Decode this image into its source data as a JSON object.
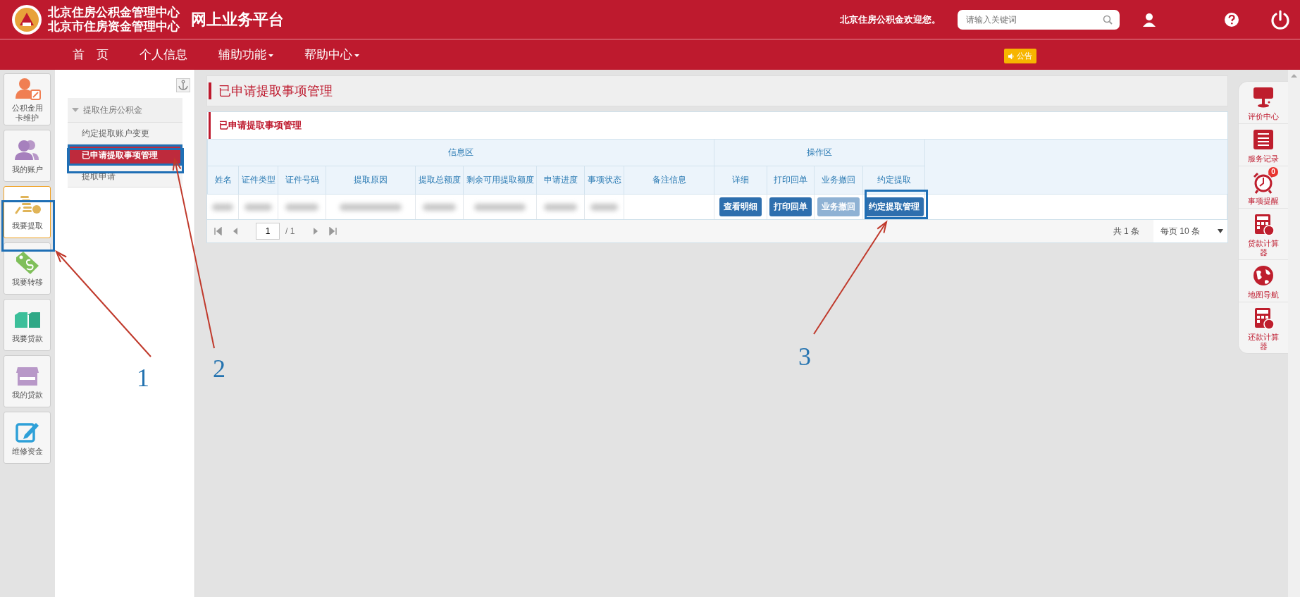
{
  "header": {
    "org_lines": [
      "北京住房公积金管理中心",
      "北京市住房资金管理中心"
    ],
    "platform": "网上业务平台",
    "welcome": "北京住房公积金欢迎您。",
    "search": {
      "placeholder": "请输入关键词"
    }
  },
  "nav": {
    "items": [
      {
        "label": "首　页",
        "dropdown": false
      },
      {
        "label": "个人信息",
        "dropdown": false
      },
      {
        "label": "辅助功能",
        "dropdown": true
      },
      {
        "label": "帮助中心",
        "dropdown": true
      }
    ],
    "notice": "公告"
  },
  "sidebar": {
    "items": [
      {
        "label": "公积金用卡维护",
        "selected": false
      },
      {
        "label": "我的账户",
        "selected": false
      },
      {
        "label": "我要提取",
        "selected": true
      },
      {
        "label": "我要转移",
        "selected": false
      },
      {
        "label": "我要贷款",
        "selected": false
      },
      {
        "label": "我的贷款",
        "selected": false
      },
      {
        "label": "维修资金",
        "selected": false
      }
    ]
  },
  "submenu": {
    "group": "提取住房公积金",
    "expanded": true,
    "items": [
      {
        "label": "约定提取账户变更",
        "selected": false
      },
      {
        "label": "已申请提取事项管理",
        "selected": true
      },
      {
        "label": "提取申请",
        "selected": false
      }
    ]
  },
  "page_title": "已申请提取事项管理",
  "card_title": "已申请提取事项管理",
  "table": {
    "groups": [
      {
        "label": "信息区",
        "columns": [
          "姓名",
          "证件类型",
          "证件号码",
          "提取原因",
          "提取总额度",
          "剩余可用提取额度",
          "申请进度",
          "事项状态",
          "备注信息"
        ]
      },
      {
        "label": "操作区",
        "columns": [
          "详细",
          "打印回单",
          "业务撤回",
          "约定提取"
        ]
      }
    ],
    "rows": [
      {
        "cells": [
          {
            "kind": "blurred"
          },
          {
            "kind": "blurred"
          },
          {
            "kind": "blurred"
          },
          {
            "kind": "blurred"
          },
          {
            "kind": "blurred"
          },
          {
            "kind": "blurred"
          },
          {
            "kind": "blurred"
          },
          {
            "kind": "blurred"
          },
          {
            "kind": "empty"
          }
        ],
        "actions": [
          {
            "label": "查看明细",
            "disabled": false
          },
          {
            "label": "打印回单",
            "disabled": false
          },
          {
            "label": "业务撤回",
            "disabled": true
          },
          {
            "label": "约定提取管理",
            "disabled": false
          }
        ]
      }
    ]
  },
  "pager": {
    "page": "1",
    "of": "/ 1",
    "total": "共 1 条",
    "per_page": "每页 10 条"
  },
  "right_panel": {
    "items": [
      {
        "label": "评价中心"
      },
      {
        "label": "服务记录"
      },
      {
        "label": "事项提醒",
        "badge": "0"
      },
      {
        "label": "贷款计算器"
      },
      {
        "label": "地图导航"
      },
      {
        "label": "还款计算器"
      }
    ]
  },
  "annotations": [
    {
      "label": "1"
    },
    {
      "label": "2"
    },
    {
      "label": "3"
    }
  ]
}
